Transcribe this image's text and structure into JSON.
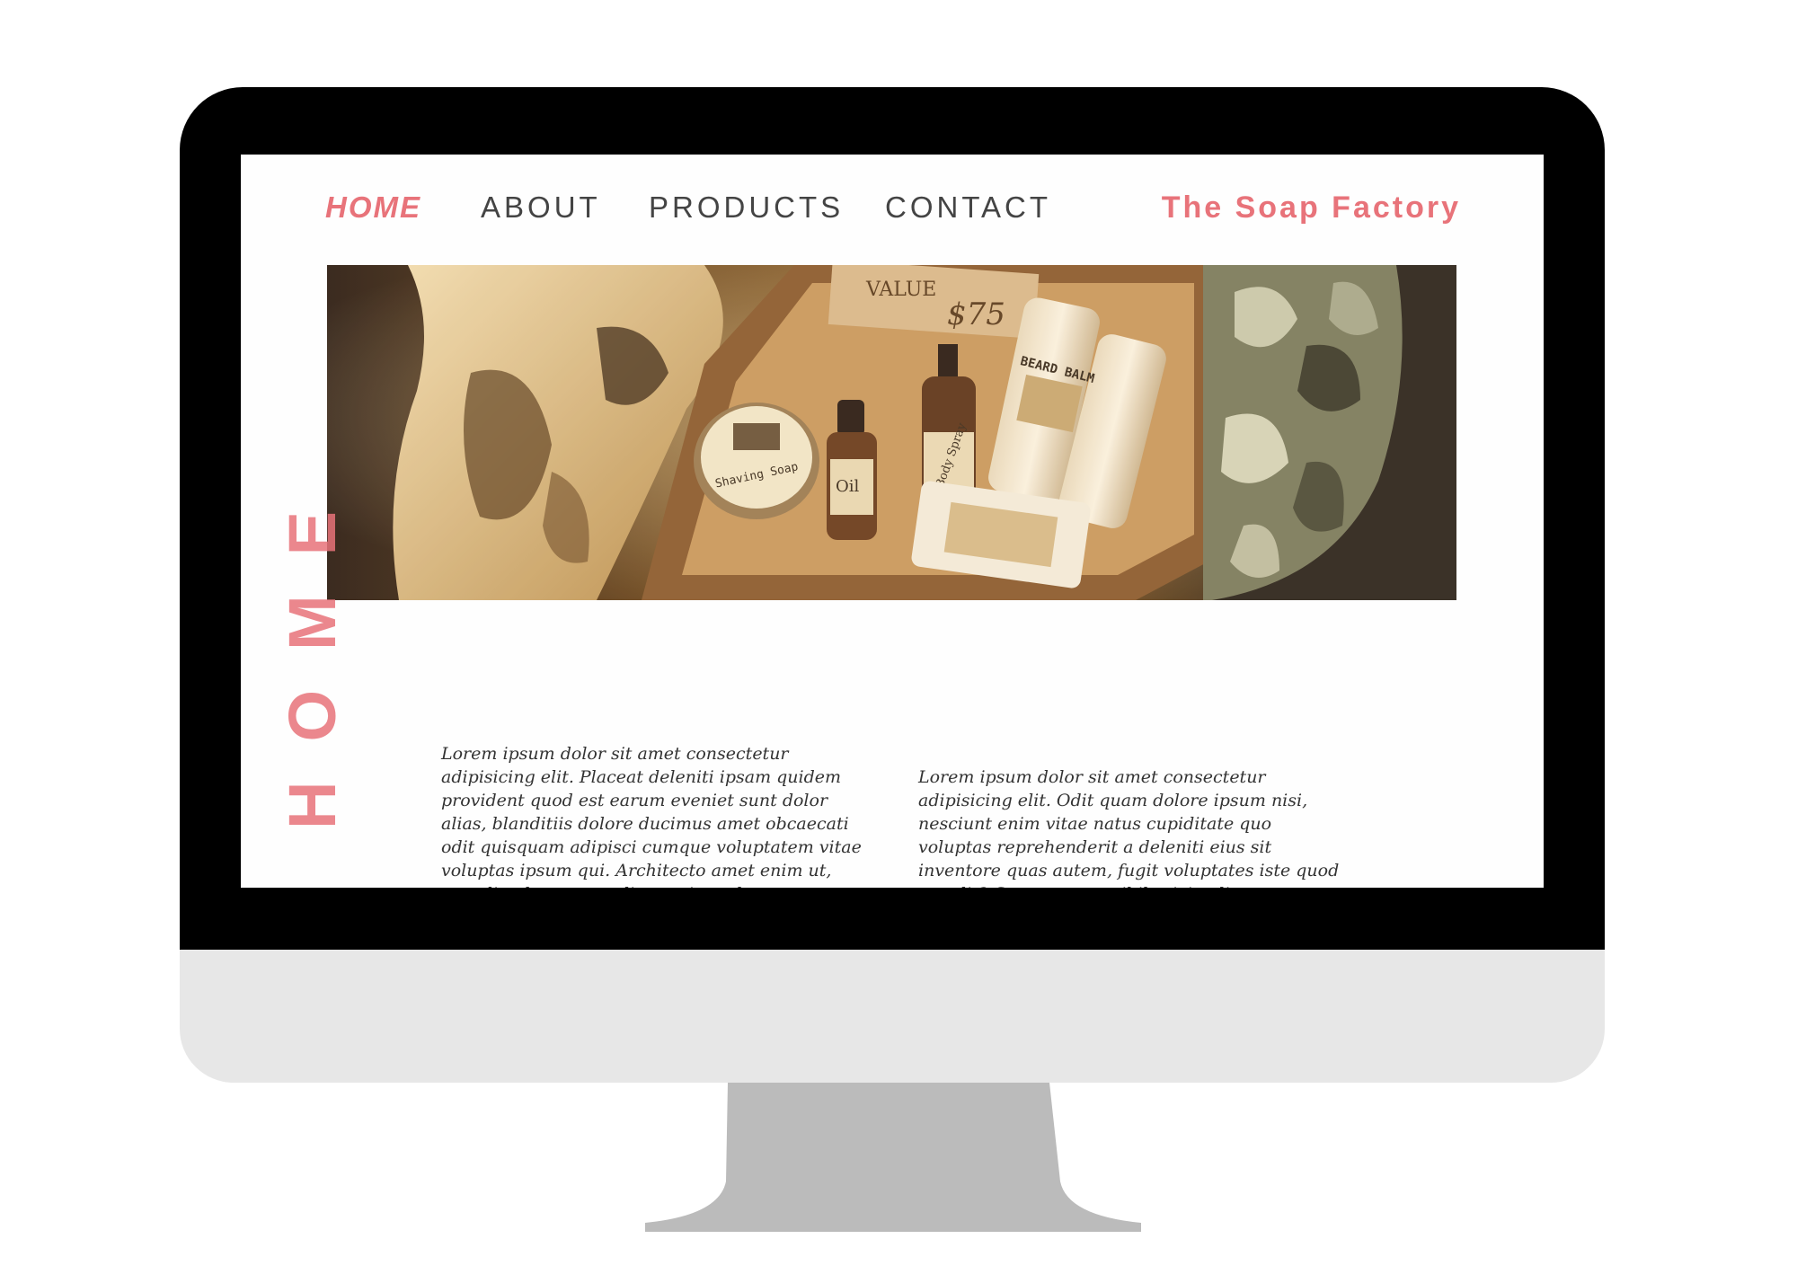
{
  "nav": {
    "items": [
      {
        "label": "HOME",
        "active": true
      },
      {
        "label": "ABOUT",
        "active": false
      },
      {
        "label": "PRODUCTS",
        "active": false
      },
      {
        "label": "CONTACT",
        "active": false
      }
    ]
  },
  "brand": {
    "name": "The Soap Factory"
  },
  "hero": {
    "label_top": "VALUE",
    "price": "$75",
    "soap_tin": "Shaving Soap",
    "bottle_oil": "Oil",
    "bottle_spray": "Body Spray",
    "stick_balm": "BEARD BALM"
  },
  "page": {
    "vertical_title": "HOME"
  },
  "content": {
    "left_text": "Lorem ipsum dolor sit amet consectetur adipisicing elit. Placeat deleniti ipsam quidem provident quod est earum eveniet sunt dolor alias, blanditiis dolore ducimus amet obcaecati odit quisquam adipisci cumque voluptatem vitae voluptas ipsum qui. Architecto amet enim ut, repudiandae commodi asperiores harum sunt dolor.",
    "right_text": "Lorem ipsum dolor sit amet consectetur adipisicing elit. Odit quam dolore ipsum nisi, nesciunt enim vitae natus cupiditate quo voluptas reprehenderit a deleniti eius sit inventore quas autem, fugit voluptates iste quod et velit? Consequatur nihil reiciendis tempore."
  },
  "colors": {
    "accent": "#e8737a",
    "nav_text": "#444444",
    "body_text": "#333333",
    "bezel": "#000000",
    "chin": "#e7e7e7",
    "stand": "#bbbbbb"
  }
}
